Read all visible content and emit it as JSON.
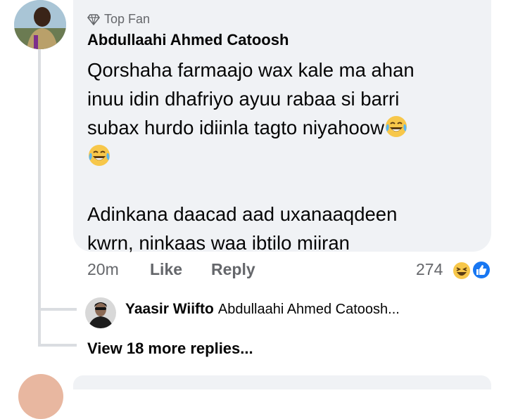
{
  "comment": {
    "badge": "Top Fan",
    "author": "Abdullaahi Ahmed Catoosh",
    "lines": [
      "Qorshaha farmaajo wax kale ma ahan",
      "inuu idin dhafriyo ayuu rabaa si barri",
      "subax hurdo idiinla tagto niyahoow"
    ],
    "lines2": [
      "Adinkana daacad aad uxanaaqdeen",
      "kwrn, ninkaas waa ibtilo miiran"
    ],
    "time": "20m",
    "like_label": "Like",
    "reply_label": "Reply",
    "reaction_count": "274",
    "reactions": [
      "haha-icon",
      "like-icon"
    ]
  },
  "reply_preview": {
    "author": "Yaasir Wiifto",
    "text": "Abdullaahi Ahmed Catoosh..."
  },
  "more_replies": "View 18 more replies...",
  "colors": {
    "bubble": "#f0f2f5",
    "secondary_text": "#65676b",
    "like_blue": "#1877f2",
    "emoji_yellow": "#f7c74a"
  }
}
